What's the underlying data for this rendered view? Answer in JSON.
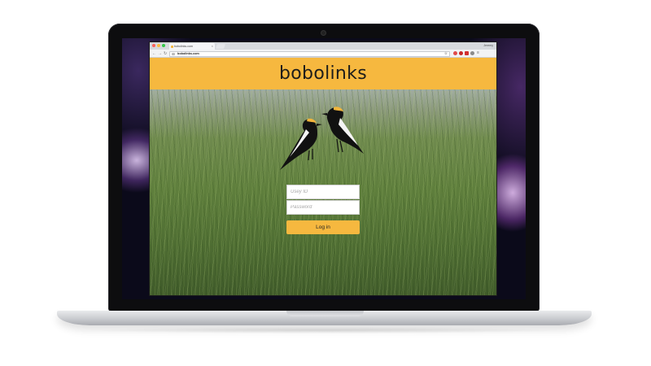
{
  "browser": {
    "tab_title": "bobolinks.com",
    "tab_close": "×",
    "user_name": "Jeremy",
    "url": "bobolinks.com",
    "nav": {
      "back": "←",
      "forward": "→",
      "reload": "↻"
    },
    "bookmark_star": "☆",
    "window_controls": {
      "close_color": "#fc605b",
      "minimize_color": "#fdbc40",
      "zoom_color": "#34c84a"
    },
    "extensions": [
      "pocket-icon",
      "adblock-icon",
      "abp-icon",
      "music-icon",
      "menu-icon"
    ]
  },
  "site": {
    "brand": "bobolinks",
    "brand_color": "#f6b83f",
    "logo_icon": "bobolink-birds-icon"
  },
  "login_form": {
    "user_id_placeholder": "Usey ID",
    "password_placeholder": "Password",
    "submit_label": "Log in"
  }
}
